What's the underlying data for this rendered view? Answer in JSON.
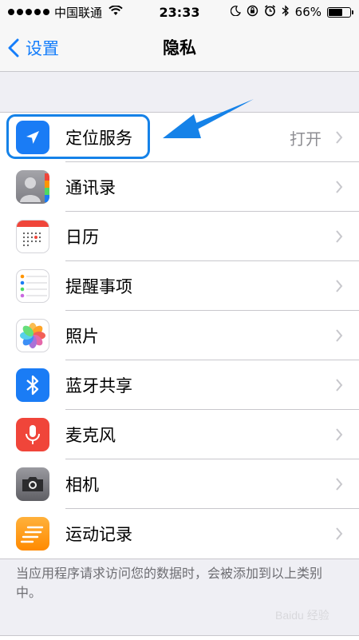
{
  "status_bar": {
    "carrier": "中国联通",
    "time": "23:33",
    "battery_percent": "66%",
    "battery_level": 0.66
  },
  "nav": {
    "back_label": "设置",
    "title": "隐私"
  },
  "privacy_items": [
    {
      "label": "定位服务",
      "value": "打开",
      "icon": "location-arrow-icon",
      "color": "#1a7cf5"
    },
    {
      "label": "通讯录",
      "icon": "contacts-icon",
      "color": "#8e8e93"
    },
    {
      "label": "日历",
      "icon": "calendar-icon",
      "color": "#ffffff"
    },
    {
      "label": "提醒事项",
      "icon": "reminders-icon",
      "color": "#ffffff"
    },
    {
      "label": "照片",
      "icon": "photos-icon",
      "color": "#ffffff"
    },
    {
      "label": "蓝牙共享",
      "icon": "bluetooth-icon",
      "color": "#1a7cf5"
    },
    {
      "label": "麦克风",
      "icon": "microphone-icon",
      "color": "#f0453a"
    },
    {
      "label": "相机",
      "icon": "camera-icon",
      "color": "#6d6d72"
    },
    {
      "label": "运动记录",
      "icon": "motion-icon",
      "color": "#ff9500"
    }
  ],
  "footer_text": "当应用程序请求访问您的数据时，会被添加到以上类别中。",
  "watermark": "Baidu 经验"
}
